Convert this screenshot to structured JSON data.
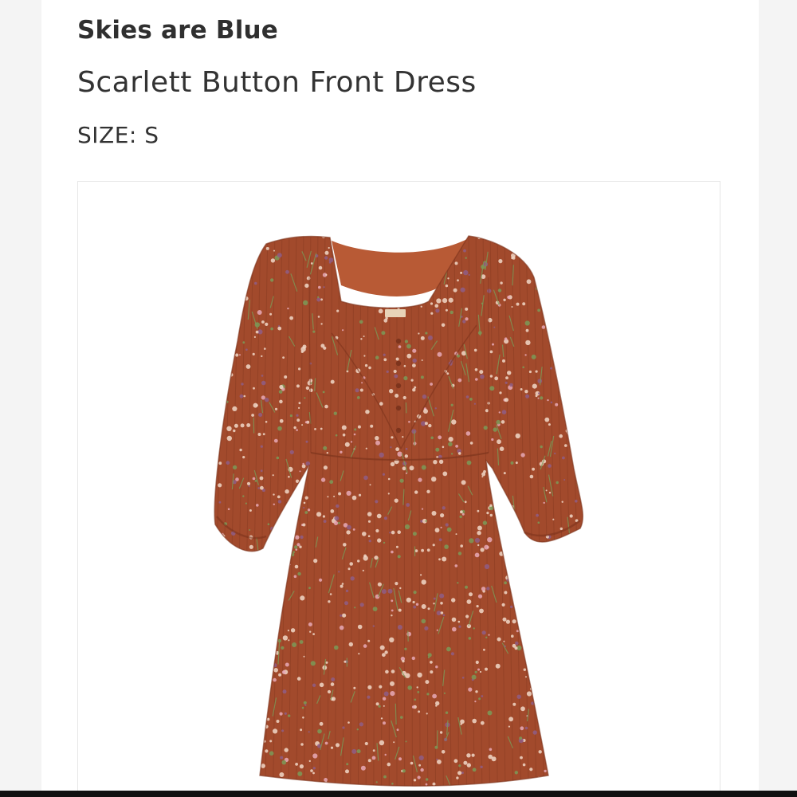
{
  "listing": {
    "brand": "Skies are Blue",
    "product_name": "Scarlett Button Front Dress",
    "size_label": "SIZE:",
    "size_value": "S"
  },
  "image": {
    "subject": "dress-photo",
    "colors": {
      "fabric": "#a24a2c",
      "fabric_dark": "#7d341d",
      "lining": "#b85a35",
      "print_light": "#f1d8c8",
      "print_pink": "#e7a9b7",
      "print_purple": "#8f5d86",
      "print_green": "#7b9a58",
      "background": "#ffffff"
    }
  }
}
